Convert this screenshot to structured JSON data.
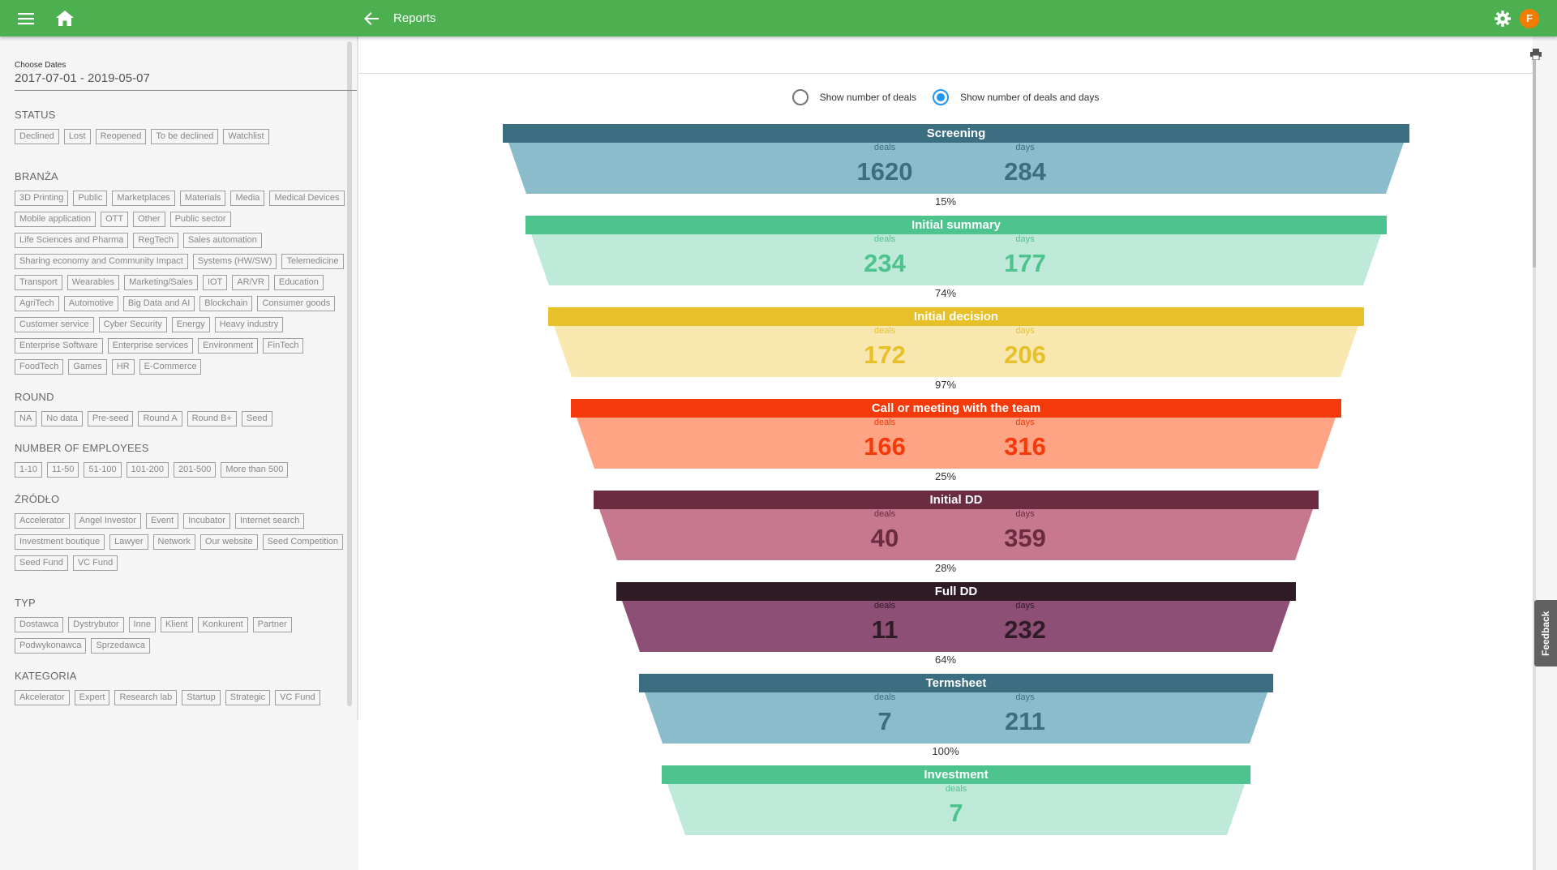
{
  "header": {
    "title": "Reports",
    "avatar_letter": "F",
    "color": "#4caf50"
  },
  "sidebar": {
    "date_label": "Choose Dates",
    "date_range": "2017-07-01 - 2019-05-07",
    "sections": [
      {
        "title": "STATUS",
        "chips": [
          "Declined",
          "Lost",
          "Reopened",
          "To be declined",
          "Watchlist"
        ]
      },
      {
        "title": "BRANŻA",
        "chips": [
          "3D Printing",
          "Public",
          "Marketplaces",
          "Materials",
          "Media",
          "Medical Devices",
          "Mobile application",
          "OTT",
          "Other",
          "Public sector",
          "Life Sciences and Pharma",
          "RegTech",
          "Sales automation",
          "Sharing economy and Community Impact",
          "Systems (HW/SW)",
          "Telemedicine",
          "Transport",
          "Wearables",
          "Marketing/Sales",
          "IOT",
          "AR/VR",
          "Education",
          "AgriTech",
          "Automotive",
          "Big Data and AI",
          "Blockchain",
          "Consumer goods",
          "Customer service",
          "Cyber Security",
          "Energy",
          "Heavy industry",
          "Enterprise Software",
          "Enterprise services",
          "Environment",
          "FinTech",
          "FoodTech",
          "Games",
          "HR",
          "E-Commerce"
        ]
      },
      {
        "title": "ROUND",
        "chips": [
          "NA",
          "No data",
          "Pre-seed",
          "Round A",
          "Round B+",
          "Seed"
        ]
      },
      {
        "title": "NUMBER OF EMPLOYEES",
        "chips": [
          "1-10",
          "11-50",
          "51-100",
          "101-200",
          "201-500",
          "More than 500"
        ]
      },
      {
        "title": "ŹRÓDŁO",
        "chips": [
          "Accelerator",
          "Angel Investor",
          "Event",
          "Incubator",
          "Internet search",
          "Investment boutique",
          "Lawyer",
          "Network",
          "Our website",
          "Seed Competition",
          "Seed Fund",
          "VC Fund"
        ]
      },
      {
        "title": "TYP",
        "chips": [
          "Dostawca",
          "Dystrybutor",
          "Inne",
          "Klient",
          "Konkurent",
          "Partner",
          "Podwykonawca",
          "Sprzedawca"
        ]
      },
      {
        "title": "KATEGORIA",
        "chips": [
          "Akcelerator",
          "Expert",
          "Research lab",
          "Startup",
          "Strategic",
          "VC Fund"
        ]
      }
    ]
  },
  "options": {
    "deals_only": "Show number of deals",
    "deals_and_days": "Show number of deals and days",
    "selected": "deals_and_days"
  },
  "funnel": {
    "deals_label": "deals",
    "days_label": "days",
    "stages": [
      {
        "name": "Screening",
        "deals": "1620",
        "days": "284",
        "pct": "15%",
        "head": "#3b6e80",
        "body": "#8abccc",
        "text": "#3b6e80"
      },
      {
        "name": "Initial summary",
        "deals": "234",
        "days": "177",
        "pct": "74%",
        "head": "#4dc48e",
        "body": "#bfe9d8",
        "text": "#4dc48e"
      },
      {
        "name": "Initial decision",
        "deals": "172",
        "days": "206",
        "pct": "97%",
        "head": "#e8c12a",
        "body": "#f8e8b0",
        "text": "#e8c12a"
      },
      {
        "name": "Call or meeting with the team",
        "deals": "166",
        "days": "316",
        "pct": "25%",
        "head": "#f43a0a",
        "body": "#fea383",
        "text": "#f43a0a"
      },
      {
        "name": "Initial DD",
        "deals": "40",
        "days": "359",
        "pct": "28%",
        "head": "#6b2b40",
        "body": "#c6788f",
        "text": "#6b2b40"
      },
      {
        "name": "Full DD",
        "deals": "11",
        "days": "232",
        "pct": "64%",
        "head": "#2e1b25",
        "body": "#8e4f76",
        "text": "#2e1b25"
      },
      {
        "name": "Termsheet",
        "deals": "7",
        "days": "211",
        "pct": "100%",
        "head": "#3b6e80",
        "body": "#8abccc",
        "text": "#3b6e80"
      },
      {
        "name": "Investment",
        "deals": "7",
        "days": null,
        "pct": null,
        "head": "#4dc48e",
        "body": "#bfe9d8",
        "text": "#4dc48e"
      }
    ]
  },
  "feedback_label": "Feedback"
}
